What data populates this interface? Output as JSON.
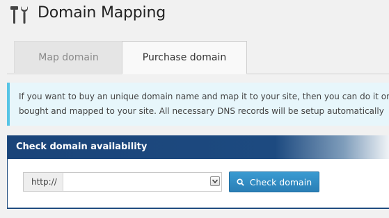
{
  "header": {
    "title": "Domain Mapping",
    "icon": "tools-icon"
  },
  "tabs": [
    {
      "label": "Map domain",
      "active": false
    },
    {
      "label": "Purchase domain",
      "active": true
    }
  ],
  "notice": {
    "line1": "If you want to buy an unique domain name and map it to your site, then you can do it on",
    "line2": "bought and mapped to your site. All necessary DNS records will be setup automatically"
  },
  "panel": {
    "title": "Check domain availability",
    "url_prefix": "http://",
    "url_value": "",
    "url_placeholder": "",
    "check_button_label": "Check domain",
    "check_button_icon": "search-icon"
  },
  "colors": {
    "panel_header": "#1d4a80",
    "button": "#2e86bd",
    "notice_bg": "#e7f6fb",
    "notice_border": "#57c4e5"
  }
}
